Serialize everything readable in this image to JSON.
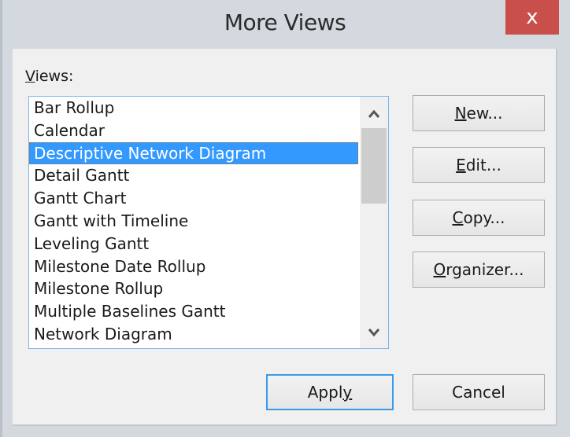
{
  "dialog": {
    "title": "More Views",
    "close_label": "x"
  },
  "views": {
    "label_underlined": "V",
    "label_rest": "iews:",
    "items": [
      "Bar Rollup",
      "Calendar",
      "Descriptive Network Diagram",
      "Detail Gantt",
      "Gantt Chart",
      "Gantt with Timeline",
      "Leveling Gantt",
      "Milestone Date Rollup",
      "Milestone Rollup",
      "Multiple Baselines Gantt",
      "Network Diagram"
    ],
    "selected": "Descriptive Network Diagram"
  },
  "buttons": {
    "new": {
      "accel": "N",
      "rest": "ew..."
    },
    "edit": {
      "accel": "E",
      "rest": "dit..."
    },
    "copy": {
      "accel": "C",
      "rest": "opy..."
    },
    "organizer": {
      "accel": "O",
      "rest": "rganizer..."
    },
    "apply": {
      "pre": "Appl",
      "accel": "y"
    },
    "cancel": {
      "label": "Cancel"
    }
  },
  "scrollbar": {
    "up_icon": "chevron-up-icon",
    "down_icon": "chevron-down-icon"
  },
  "colors": {
    "selection": "#3399ff",
    "close_button": "#c9504a",
    "default_button_border": "#3c9ae8"
  }
}
